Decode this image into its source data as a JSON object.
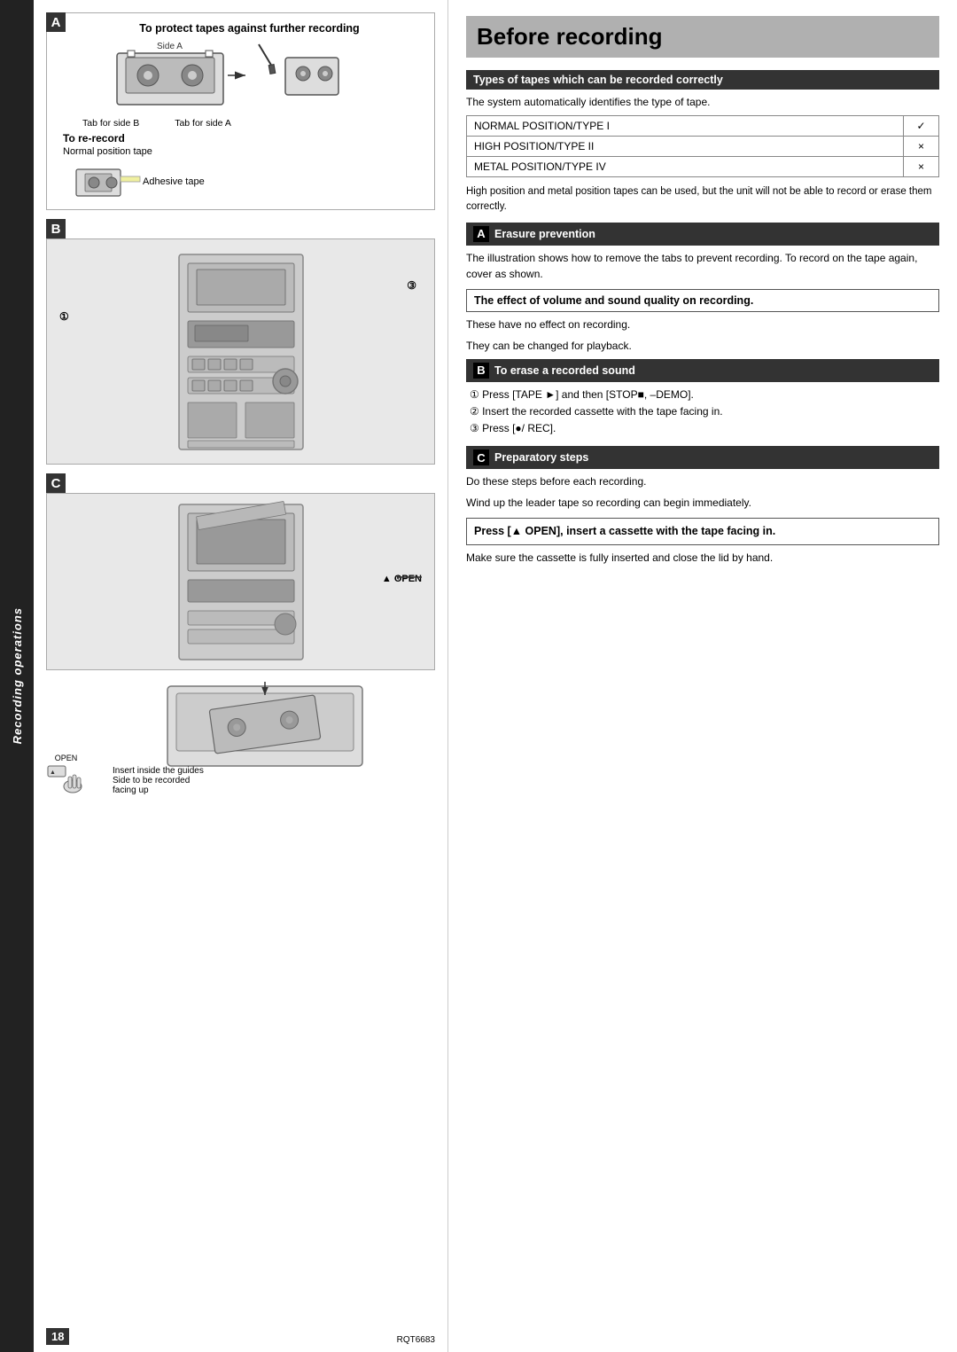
{
  "sidebar": {
    "text": "Recording operations"
  },
  "left_panel": {
    "section_a": {
      "label": "A",
      "title": "To protect tapes against further recording",
      "side_a_label": "Side A",
      "tab_b_label": "Tab for side B",
      "tab_a_label": "Tab for side A",
      "re_record_title": "To re-record",
      "re_record_sub": "Normal position tape",
      "adhesive_label": "Adhesive tape"
    },
    "section_b": {
      "label": "B",
      "callout_1": "①",
      "callout_3": "③"
    },
    "section_c": {
      "label": "C",
      "open_label": "▲ OPEN"
    },
    "bottom": {
      "open_button_label": "OPEN",
      "insert_label": "Insert inside the guides",
      "side_label": "Side to be recorded",
      "facing_label": "facing up"
    }
  },
  "right_panel": {
    "page_title": "Before recording",
    "types_section": {
      "header": "Types of tapes which can be recorded correctly",
      "body": "The system automatically identifies the type of tape.",
      "table": [
        {
          "name": "NORMAL POSITION/TYPE I",
          "symbol": "✓"
        },
        {
          "name": "HIGH POSITION/TYPE II",
          "symbol": "×"
        },
        {
          "name": "METAL POSITION/TYPE IV",
          "symbol": "×"
        }
      ],
      "note": "High position and metal position tapes can be used, but the unit will not be able to record or erase them correctly."
    },
    "erasure_section": {
      "badge": "A",
      "header": "Erasure prevention",
      "body": "The illustration shows how to remove the tabs to prevent recording. To record on the tape again, cover as shown."
    },
    "volume_section": {
      "header": "The effect of volume and sound quality on recording.",
      "line1": "These have no effect on recording.",
      "line2": "They can be changed for playback."
    },
    "erase_section": {
      "badge": "B",
      "header": "To erase a recorded sound",
      "step1": "① Press [TAPE ►] and then [STOP■, –DEMO].",
      "step2": "② Insert the recorded cassette with the tape facing in.",
      "step3": "③ Press [●/  REC]."
    },
    "preparatory_section": {
      "badge": "C",
      "header": "Preparatory steps",
      "line1": "Do these steps before each recording.",
      "line2": "Wind up the leader tape so recording can begin immediately."
    },
    "press_section": {
      "header": "Press [▲ OPEN], insert a cassette with the tape facing in.",
      "body": "Make sure the cassette is fully inserted and close the lid by hand."
    }
  },
  "page_number": "18",
  "model_number": "RQT6683"
}
